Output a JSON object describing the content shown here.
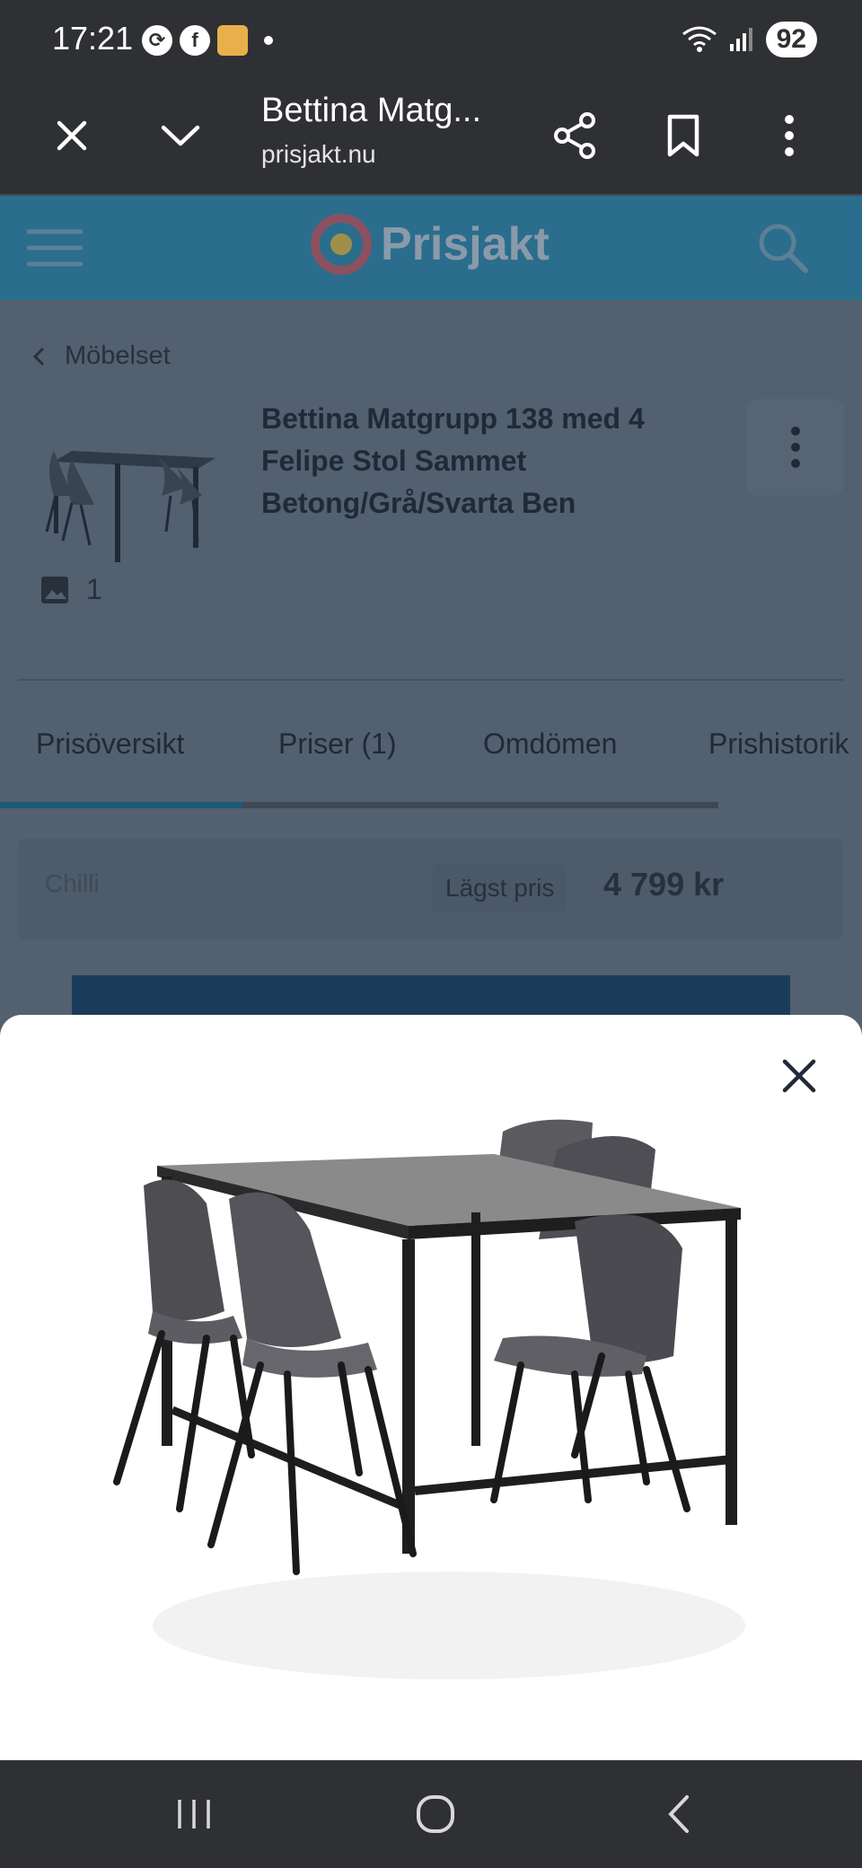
{
  "status_bar": {
    "time": "17:21",
    "app_icons": [
      "sync-icon",
      "facebook-icon",
      "burger-app-icon"
    ],
    "battery": "92"
  },
  "browser": {
    "title": "Bettina Matg...",
    "url": "prisjakt.nu"
  },
  "site": {
    "logo_text": "Prisjakt"
  },
  "breadcrumb": {
    "label": "Möbelset"
  },
  "product": {
    "title": "Bettina Matgrupp 138 med 4 Felipe Stol Sammet Betong/Grå/Svarta Ben",
    "image_count": "1"
  },
  "tabs": [
    {
      "label": "Prisöversikt",
      "active": true
    },
    {
      "label": "Priser (1)",
      "active": false
    },
    {
      "label": "Omdömen",
      "active": false
    },
    {
      "label": "Prishistorik",
      "active": false
    }
  ],
  "price_row": {
    "shop": "Chilli",
    "lowest_label": "Lägst pris",
    "price": "4 799 kr"
  },
  "colors": {
    "site_bar": "#2a6d8c",
    "overlay_page": "#526070",
    "system_bar": "#2f3033",
    "modal": "#ffffff"
  }
}
